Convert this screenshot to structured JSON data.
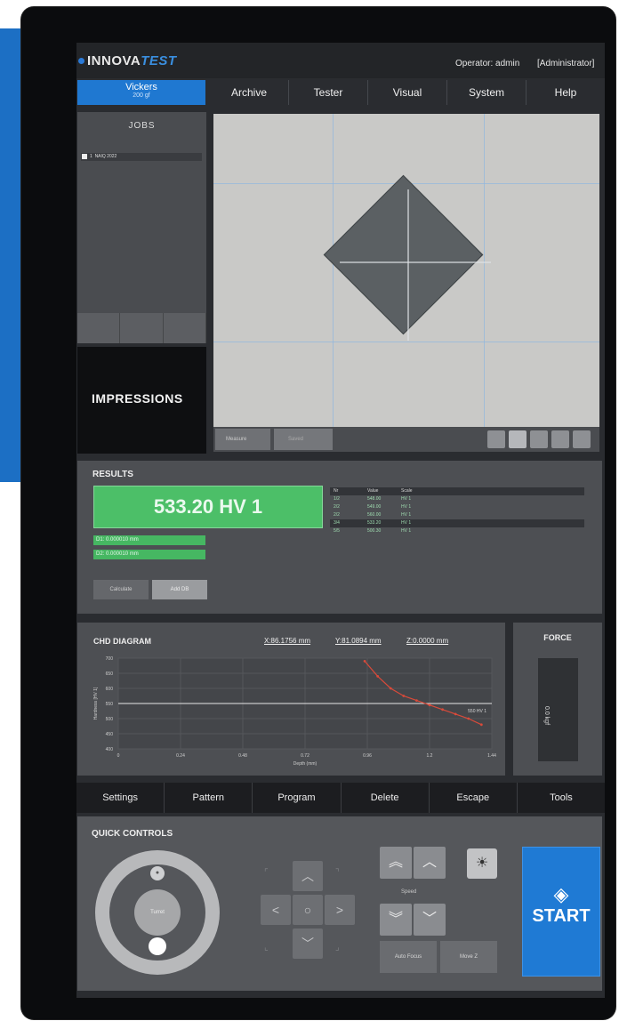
{
  "header": {
    "brand_prefix": "INNOVA",
    "brand_suffix": "TEST",
    "operator": "Operator: admin",
    "role": "[Administrator]"
  },
  "mode": {
    "label": "Vickers",
    "sub": "200 gf"
  },
  "menu": [
    "Archive",
    "Tester",
    "Visual",
    "System",
    "Help"
  ],
  "jobs": {
    "title": "JOBS",
    "items": [
      {
        "num": "1",
        "name": "NAIQ 2022"
      }
    ]
  },
  "impressions_label": "IMPRESSIONS",
  "image_view": {
    "btn_left": "Measure",
    "btn_right": "Saved"
  },
  "results": {
    "title": "RESULTS",
    "hardness": "533.20 HV 1",
    "d1": "D1: 0.000010 mm",
    "d2": "D2: 0.000010 mm",
    "btn_left": "Calculate",
    "btn_right": "Add DB",
    "table": {
      "headers": [
        "Nr",
        "Value",
        "Scale"
      ],
      "rows": [
        [
          "1/2",
          "548.00",
          "HV 1"
        ],
        [
          "2/2",
          "549.00",
          "HV 1"
        ],
        [
          "2/2",
          "560.00",
          "HV 1"
        ],
        [
          "3/4",
          "533.20",
          "HV 1"
        ],
        [
          "5/5",
          "500.30",
          "HV 1"
        ]
      ]
    }
  },
  "chd": {
    "title": "CHD DIAGRAM",
    "x_coord": "X:86.1756 mm",
    "y_coord": "Y:81.0894 mm",
    "z_coord": "Z:0.0000 mm"
  },
  "force": {
    "title": "FORCE",
    "value": "0.0 kgf"
  },
  "bottom_menu": [
    "Settings",
    "Pattern",
    "Program",
    "Delete",
    "Escape",
    "Tools"
  ],
  "quick_controls": {
    "title": "QUICK CONTROLS",
    "knob_label": "Turret",
    "focus_label": "Speed",
    "btn_a": "Auto Focus",
    "btn_b": "Move Z"
  },
  "start_label": "START",
  "chart_data": {
    "type": "line",
    "title": "CHD DIAGRAM",
    "xlabel": "Depth (mm)",
    "ylabel": "Hardness [HV 1]",
    "xlim": [
      0,
      1.44
    ],
    "ylim": [
      400,
      700
    ],
    "x_ticks": [
      "0",
      "0.24",
      "0.48",
      "0.72",
      "0.96",
      "1.2",
      "1.44"
    ],
    "y_ticks": [
      "400",
      "450",
      "500",
      "550",
      "600",
      "650",
      "700"
    ],
    "limit_line": 550,
    "limit_label": "550 HV 1",
    "series": [
      {
        "color": "#d94a3a",
        "x": [
          0.95,
          1.0,
          1.05,
          1.1,
          1.15,
          1.2,
          1.25,
          1.3,
          1.35,
          1.4
        ],
        "y": [
          690,
          640,
          600,
          575,
          560,
          545,
          530,
          515,
          500,
          480
        ]
      }
    ]
  }
}
